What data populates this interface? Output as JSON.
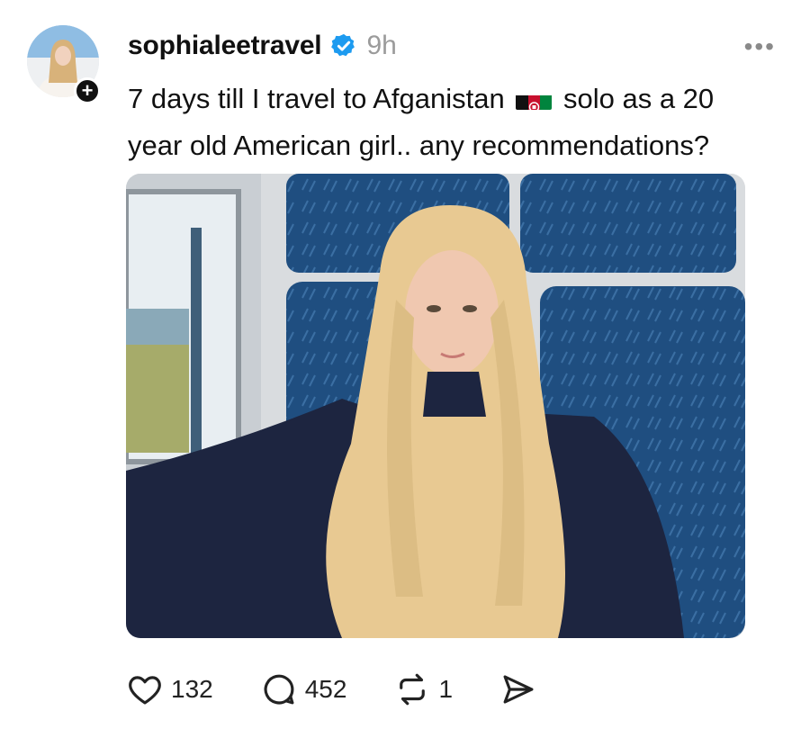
{
  "post": {
    "username": "sophialeetravel",
    "time": "9h",
    "more_label": "•••",
    "follow_symbol": "+",
    "text_before_flag": "7 days till I travel to Afganistan",
    "text_after_flag": "solo as a 20 year old American girl.. any recommendations?",
    "flag_icon": "afghanistan-flag-icon",
    "image_alt": "post photo"
  },
  "actions": {
    "likes": "132",
    "comments": "452",
    "reposts": "1"
  },
  "colors": {
    "verified": "#1d9bf0",
    "seat": "#1f4e80",
    "hair": "#e8c992"
  }
}
